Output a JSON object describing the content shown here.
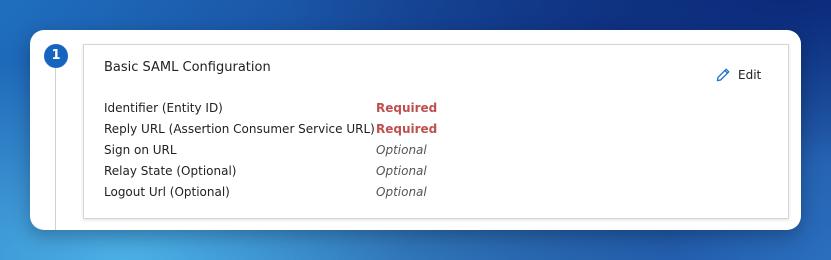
{
  "step": {
    "number": "1"
  },
  "card": {
    "title": "Basic SAML Configuration",
    "edit_label": "Edit"
  },
  "fields": [
    {
      "label": "Identifier (Entity ID)",
      "status": "Required"
    },
    {
      "label": "Reply URL (Assertion Consumer Service URL)",
      "status": "Required"
    },
    {
      "label": "Sign on URL",
      "status": "Optional"
    },
    {
      "label": "Relay State (Optional)",
      "status": "Optional"
    },
    {
      "label": "Logout Url (Optional)",
      "status": "Optional"
    }
  ],
  "colors": {
    "step_badge": "#1565c0",
    "required": "#c0504d",
    "optional": "#555555"
  },
  "icons": {
    "edit": "pencil-icon"
  }
}
